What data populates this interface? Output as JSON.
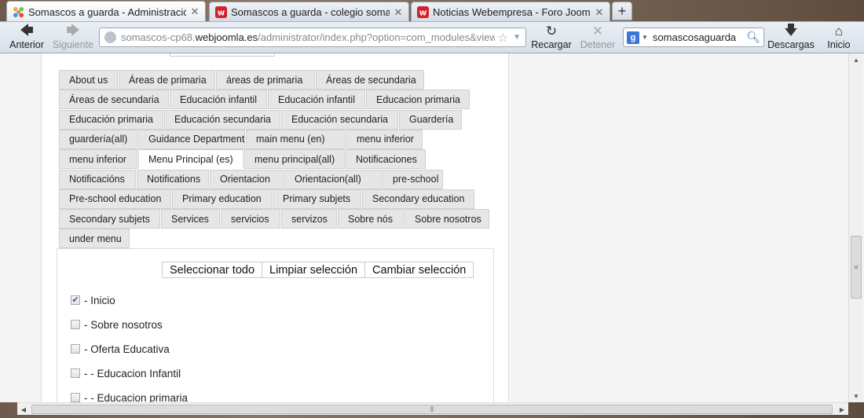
{
  "browser": {
    "tabs": [
      {
        "title": "Somascos a guarda - Administración ...",
        "icon": "joomla-icon"
      },
      {
        "title": "Somascos a guarda - colegio somasc...",
        "icon": "webempresa-icon"
      },
      {
        "title": "Noticias Webempresa - Foro Joomla!...",
        "icon": "webempresa-icon"
      }
    ],
    "new_tab_label": "+",
    "back_label": "Anterior",
    "forward_label": "Siguiente",
    "reload_label": "Recargar",
    "stop_label": "Detener",
    "downloads_label": "Descargas",
    "home_label": "Inicio",
    "url_prefix": "somascos-cp68.",
    "url_domain": "webjoomla.es",
    "url_rest": "/administrator/index.php?option=com_modules&view=m",
    "search_value": "somascosaguarda"
  },
  "menus": [
    "About us",
    "Áreas de primaria",
    "áreas de primaria",
    "Áreas de secundaria",
    "Áreas de secundaria",
    "Educación infantil",
    "Educación infantil",
    "Educacion primaria",
    "Educación primaria",
    "Educación secundaria",
    "Educación secundaria",
    "Guardería",
    "guardería(all)",
    "Guidance Department",
    "main menu (en)",
    "menu inferior",
    "menu inferior",
    "Menu Principal (es)",
    "menu principal(all)",
    "Notificaciones",
    "Notificacións",
    "Notifications",
    "Orientacion",
    "Orientacion(all)",
    "pre-school",
    "Pre-school education",
    "Primary education",
    "Primary subjets",
    "Secondary education",
    "Secondary subjets",
    "Services",
    "servicios",
    "servizos",
    "Sobre nós",
    "Sobre nosotros",
    "under menu"
  ],
  "active_menu_index": 17,
  "selection": {
    "select_all": "Seleccionar todo",
    "clear": "Limpiar selección",
    "toggle": "Cambiar selección"
  },
  "items": [
    {
      "label": "- Inicio",
      "checked": true
    },
    {
      "label": "- Sobre nosotros",
      "checked": false
    },
    {
      "label": "- Oferta Educativa",
      "checked": false
    },
    {
      "label": "- - Educacion Infantil",
      "checked": false
    },
    {
      "label": "- - Educacion primaria",
      "checked": false
    }
  ]
}
